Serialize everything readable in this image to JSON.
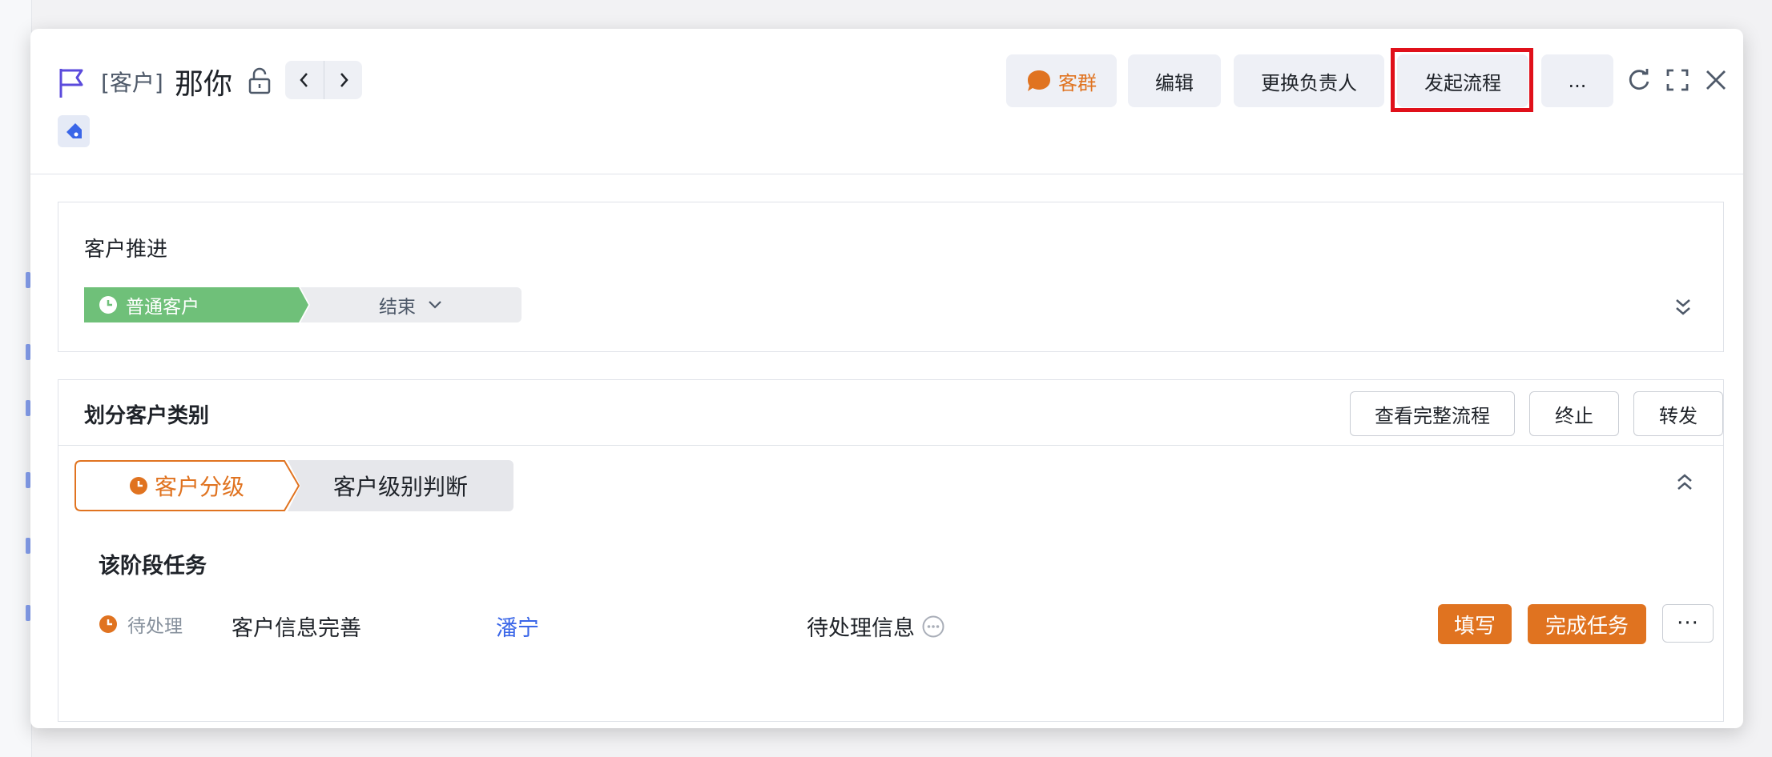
{
  "header": {
    "record_type": "[客户]",
    "record_name": "那你",
    "buttons": {
      "group_chat": "客群",
      "edit": "编辑",
      "change_owner": "更换负责人",
      "start_process": "发起流程",
      "more": "..."
    },
    "icons": [
      "flag-icon",
      "lock-icon",
      "prev-icon",
      "next-icon",
      "tag-icon",
      "chat-bubble-icon",
      "refresh-icon",
      "fullscreen-icon",
      "close-icon"
    ],
    "highlight_color": "#e0101a"
  },
  "progress_card": {
    "title": "客户推进",
    "stages": [
      {
        "label": "普通客户",
        "state": "active"
      },
      {
        "label": "结束",
        "state": "pending"
      }
    ],
    "active_color": "#6fc079"
  },
  "process_card": {
    "title": "划分客户类别",
    "buttons": {
      "view_full": "查看完整流程",
      "terminate": "终止",
      "forward": "转发"
    },
    "stages": [
      {
        "label": "客户分级",
        "state": "active"
      },
      {
        "label": "客户级别判断",
        "state": "pending"
      }
    ],
    "task_section_title": "该阶段任务",
    "task": {
      "status": "待处理",
      "name": "客户信息完善",
      "owner": "潘宁",
      "info": "待处理信息",
      "fill_label": "填写",
      "complete_label": "完成任务",
      "more_label": "···"
    },
    "accent_color": "#e07320"
  }
}
